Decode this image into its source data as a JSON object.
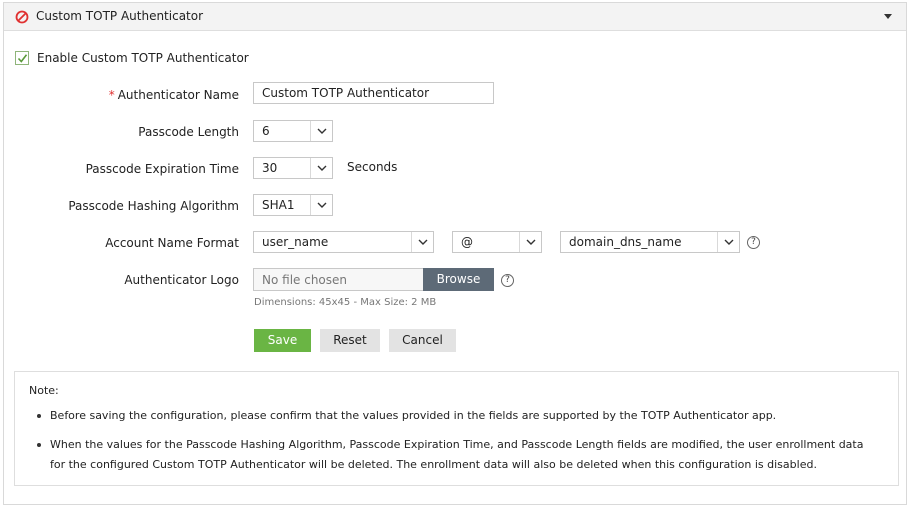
{
  "panel": {
    "title": "Custom TOTP Authenticator",
    "enable_label": "Enable Custom TOTP Authenticator",
    "enable_checked": true
  },
  "form": {
    "name_label": "Authenticator Name",
    "name_value": "Custom TOTP Authenticator",
    "passcode_length_label": "Passcode Length",
    "passcode_length_value": "6",
    "expiration_label": "Passcode Expiration Time",
    "expiration_value": "30",
    "expiration_unit": "Seconds",
    "hashing_label": "Passcode Hashing Algorithm",
    "hashing_value": "SHA1",
    "account_format_label": "Account Name Format",
    "account_format_part1": "user_name",
    "account_format_separator": "@",
    "account_format_part2": "domain_dns_name",
    "logo_label": "Authenticator Logo",
    "logo_placeholder": "No file chosen",
    "browse_label": "Browse",
    "logo_hint": "Dimensions: 45x45 - Max Size: 2 MB"
  },
  "actions": {
    "save": "Save",
    "reset": "Reset",
    "cancel": "Cancel"
  },
  "note": {
    "title": "Note:",
    "items": [
      "Before saving the configuration, please confirm that the values provided in the fields are supported by the TOTP Authenticator app.",
      "When the values for the Passcode Hashing Algorithm, Passcode Expiration Time, and Passcode Length fields are modified, the user enrollment data for the configured Custom TOTP Authenticator will be deleted. The enrollment data will also be deleted when this configuration is disabled."
    ]
  },
  "colors": {
    "save_button": "#6ab544",
    "browse_button": "#5d6a77",
    "disabled_icon": "#e03030",
    "checkbox_check": "#5a9a3a"
  },
  "icons": {
    "header": "disabled-circle-icon",
    "collapse": "caret-down-icon",
    "help": "question-circle-icon"
  }
}
